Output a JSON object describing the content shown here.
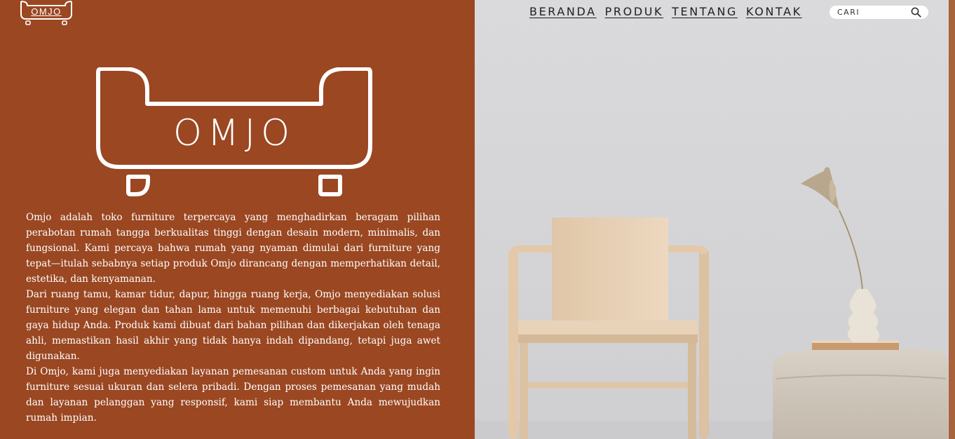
{
  "brand": {
    "name": "OMJO",
    "colors": {
      "left_panel": "#9a4722",
      "right_panel": "#d6d6d8",
      "nav_text": "#1f1f1f"
    }
  },
  "header": {
    "logo_text": "OMJO",
    "nav": [
      {
        "label": "BERANDA"
      },
      {
        "label": "PRODUK"
      },
      {
        "label": "TENTANG"
      },
      {
        "label": "KONTAK"
      }
    ],
    "search": {
      "placeholder": "CARI",
      "icon": "search-icon"
    }
  },
  "hero": {
    "logo_text": "OMJO",
    "paragraphs": [
      "Omjo adalah toko furniture terpercaya yang menghadirkan beragam pilihan perabotan rumah tangga berkualitas tinggi dengan desain modern, minimalis, dan fungsional. Kami percaya bahwa rumah yang nyaman dimulai dari furniture yang tepat—itulah sebabnya setiap produk Omjo dirancang dengan memperhatikan detail, estetika, dan kenyamanan.",
      "Dari ruang tamu, kamar tidur, dapur, hingga ruang kerja, Omjo menyediakan solusi furniture yang elegan dan tahan lama untuk memenuhi berbagai kebutuhan dan gaya hidup Anda. Produk kami dibuat dari bahan pilihan dan dikerjakan oleh tenaga ahli, memastikan hasil akhir yang tidak hanya indah dipandang, tetapi juga awet digunakan.",
      "Di Omjo, kami juga menyediakan layanan pemesanan custom untuk Anda yang ingin furniture sesuai ukuran dan selera pribadi. Dengan proses pemesanan yang mudah dan layanan pelanggan yang responsif, kami siap membantu Anda mewujudkan rumah impian."
    ]
  }
}
